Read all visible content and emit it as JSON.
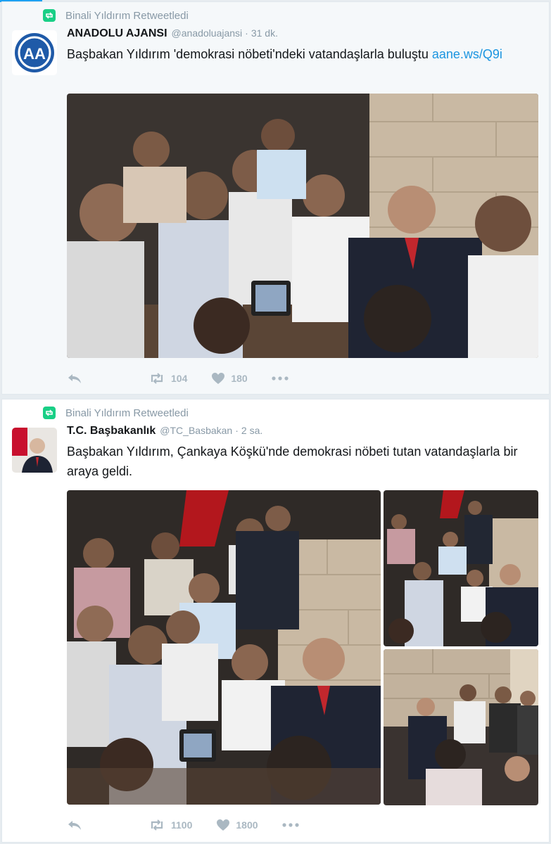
{
  "tweets": [
    {
      "retweet_label": "Binali Yıldırım Retweetledi",
      "name": "ANADOLU AJANSI",
      "handle": "@anadoluajansi",
      "separator": "·",
      "time": "31 dk.",
      "text": "Başbakan Yıldırım 'demokrasi nöbeti'ndeki vatandaşlarla buluştu",
      "link": "aane.ws/Q9i",
      "avatar_label": "AA",
      "retweets": "104",
      "likes": "180"
    },
    {
      "retweet_label": "Binali Yıldırım Retweetledi",
      "name": "T.C. Başbakanlık",
      "handle": "@TC_Basbakan",
      "separator": "·",
      "time": "2 sa.",
      "text": "Başbakan Yıldırım, Çankaya Köşkü'nde demokrasi nöbeti tutan vatandaşlarla bir araya geldi.",
      "retweets": "1100",
      "likes": "1800"
    }
  ],
  "colors": {
    "accent": "#1da1f2",
    "retweet_green": "#19cf86",
    "muted": "#8899a6",
    "action_grey": "#aab8c2"
  },
  "icons": [
    "retweet-icon",
    "reply-icon",
    "like-icon",
    "more-icon"
  ]
}
